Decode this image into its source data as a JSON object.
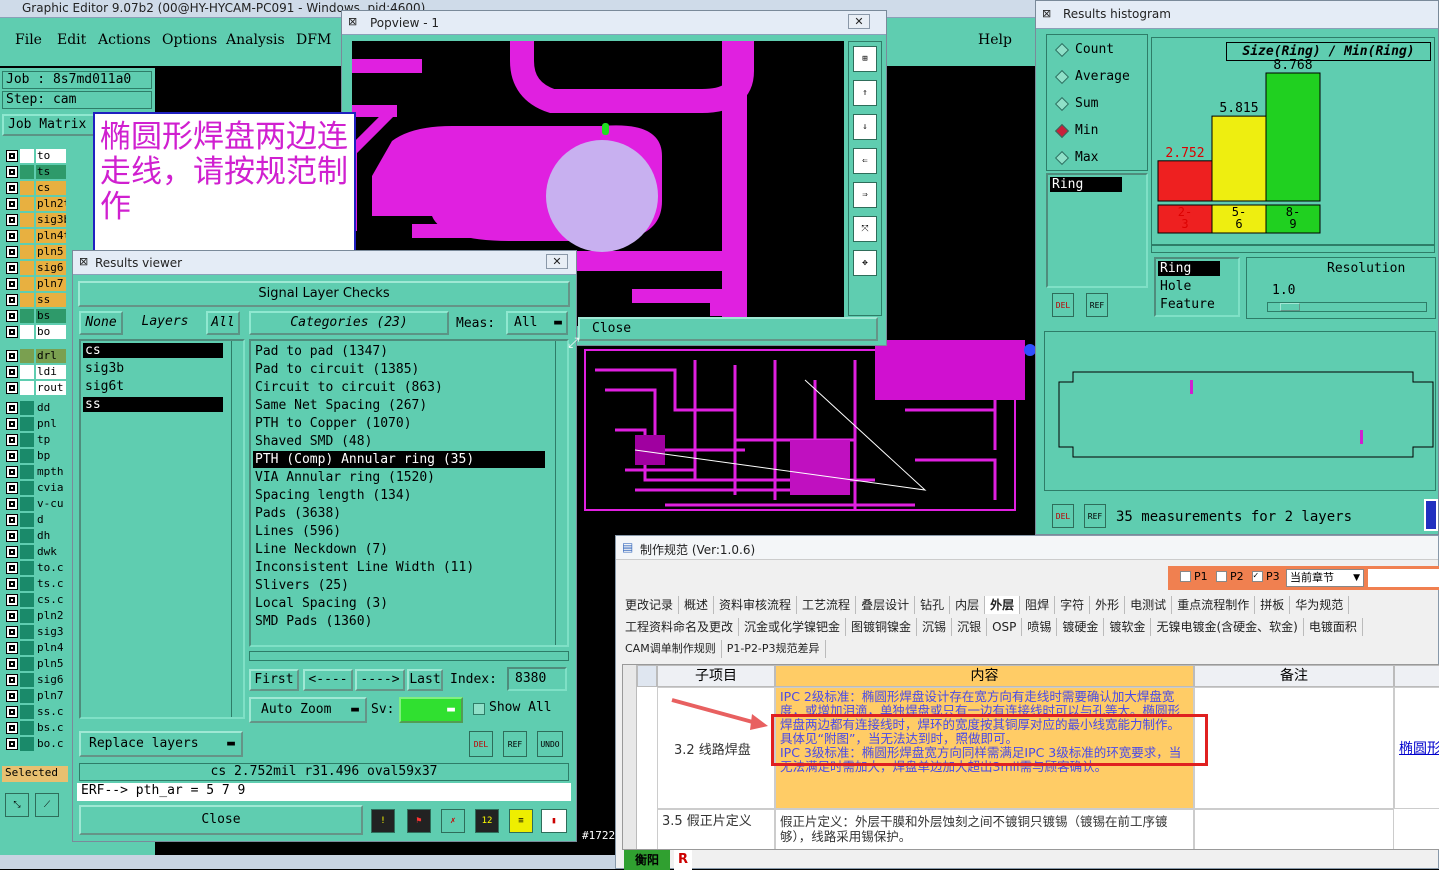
{
  "main": {
    "title": "Graphic Editor 9.07b2 (00@HY-HYCAM-PC091 - Windows, pid:4600)",
    "menu": [
      "File",
      "Edit",
      "Actions",
      "Options",
      "Analysis",
      "DFM"
    ],
    "help": "Help",
    "job": "Job : 8s7md011a0",
    "step": "Step: cam",
    "job_matrix": "Job Matrix",
    "selected": "Selected",
    "status_partial": "#1722",
    "layers": [
      {
        "name": "to",
        "color": "#ffffff"
      },
      {
        "name": "ts",
        "color": "#2e9a6a"
      },
      {
        "name": "cs",
        "color": "#e8b040"
      },
      {
        "name": "pln2t",
        "color": "#e8b040"
      },
      {
        "name": "sig3b",
        "color": "#e8b040"
      },
      {
        "name": "pln4t",
        "color": "#e8b040"
      },
      {
        "name": "pln5",
        "color": "#e8b040"
      },
      {
        "name": "sig6",
        "color": "#e8b040"
      },
      {
        "name": "pln7",
        "color": "#e8b040"
      },
      {
        "name": "ss",
        "color": "#e8b040"
      },
      {
        "name": "bs",
        "color": "#2e9a6a"
      },
      {
        "name": "bo",
        "color": "#ffffff"
      }
    ],
    "layers2": [
      {
        "name": "drl",
        "color": "#7aa050"
      },
      {
        "name": "ldi",
        "color": "#ffffff"
      },
      {
        "name": "rout",
        "color": "#ffffff"
      }
    ],
    "layers3": [
      "dd",
      "pnl",
      "tp",
      "bp",
      "mpth",
      "cvia",
      "v-cu",
      "d",
      "dh",
      "dwk",
      "to.c",
      "ts.c",
      "cs.c",
      "pln2",
      "sig3",
      "pln4",
      "pln5",
      "sig6",
      "pln7",
      "ss.c",
      "bs.c",
      "bo.c"
    ]
  },
  "note": {
    "text": "椭圆形焊盘两边连走线，请按规范制作"
  },
  "popview": {
    "title": "Popview - 1",
    "close": "Close"
  },
  "rv": {
    "title": "Results viewer",
    "header": "Signal Layer Checks",
    "none": "None",
    "layers": "Layers",
    "all": "All",
    "categories": "Categories (23)",
    "meas": "Meas:",
    "meas_val": "All",
    "layer_list": [
      "cs",
      "sig3b",
      "sig6t",
      "ss"
    ],
    "cats": [
      "Pad to pad (1347)",
      "Pad to circuit (1385)",
      "Circuit to circuit (863)",
      "Same Net Spacing (267)",
      "PTH to Copper (1070)",
      "Shaved SMD (48)",
      "PTH (Comp) Annular ring (35)",
      "VIA Annular ring (1520)",
      "Spacing length (134)",
      "Pads (3638)",
      "Lines (596)",
      "Line Neckdown (7)",
      "Inconsistent Line Width (11)",
      "Slivers (25)",
      "Local Spacing (3)",
      "SMD Pads (1360)"
    ],
    "first": "First",
    "prev": "<----",
    "next": "---->",
    "last": "Last",
    "index_label": "Index:",
    "index": "8380",
    "auto_zoom": "Auto Zoom",
    "sv": "Sv:",
    "show_all": "Show All",
    "replace": "Replace layers",
    "del": "DEL",
    "ref": "REF",
    "undo": "UNDO",
    "info": "cs 2.752mil   r31.496   oval59x37",
    "erf": "ERF--> pth_ar = 5 7 9",
    "close": "Close"
  },
  "hist": {
    "title": "Results histogram",
    "stats": [
      "Count",
      "Average",
      "Sum",
      "Min",
      "Max"
    ],
    "selected_stat": "Min",
    "chart_title": "Size(Ring) / Min(Ring)",
    "ring": "Ring",
    "list": [
      "Ring",
      "Hole",
      "Feature"
    ],
    "resolution_label": "Resolution",
    "resolution": "1.0",
    "summary": "35 measurements for 2 layers",
    "del": "DEL",
    "ref": "REF"
  },
  "chart_data": {
    "type": "bar",
    "title": "Size(Ring) / Min(Ring)",
    "categories": [
      "2-3",
      "5-6",
      "8-9"
    ],
    "values": [
      2.752,
      5.815,
      8.768
    ],
    "colors": [
      "#ee2020",
      "#eeee10",
      "#20d020"
    ]
  },
  "spec": {
    "title": "制作规范 (Ver:1.0.6)",
    "p1": "P1",
    "p2": "P2",
    "p3": "P3",
    "chapter": "当前章节",
    "tabs1": [
      "更改记录",
      "概述",
      "资料审核流程",
      "工艺流程",
      "叠层设计",
      "钻孔",
      "内层",
      "外层",
      "阻焊",
      "字符",
      "外形",
      "电测试",
      "重点流程制作",
      "拼板",
      "华为规范"
    ],
    "tabs2": [
      "工程资料命名及更改",
      "沉金或化学镍钯金",
      "图镀铜镍金",
      "沉锡",
      "沉银",
      "OSP",
      "喷锡",
      "镀硬金",
      "镀软金",
      "无镍电镀金(含硬金、软金)",
      "电镀面积"
    ],
    "tabs3": [
      "CAM调单制作规则",
      "P1-P2-P3规范差异"
    ],
    "col_sub": "子项目",
    "col_content": "内容",
    "col_note": "备注",
    "row1_id": "3.2 线路焊盘",
    "row1_p1": "IPC 2级标准：椭圆形焊盘设计存在宽方向有走线时需要确认加大焊盘宽度，或增加泪滴，单独焊盘或只有一边有连接线时可以与孔等大。椭圆形焊盘两边都有连接线时，焊环的宽度按其铜厚对应的最小线宽能力制作。具体见“附图”，当无法达到时，照做即可。",
    "row1_p2": "IPC 3级标准：椭圆形焊盘宽方向同样需满足IPC 3级标准的环宽要求，当无法满足时需加大，焊盘单边加大超出3mil需与顾客确认。",
    "row1_link": "椭圆形",
    "row2_id": "3.5 假正片定义",
    "row2_text": "假正片定义：外层干膜和外层蚀刻之间不镀铜只镀锡（镀锡在前工序镀够），线路采用锡保护。",
    "bottom": "衡阳"
  }
}
